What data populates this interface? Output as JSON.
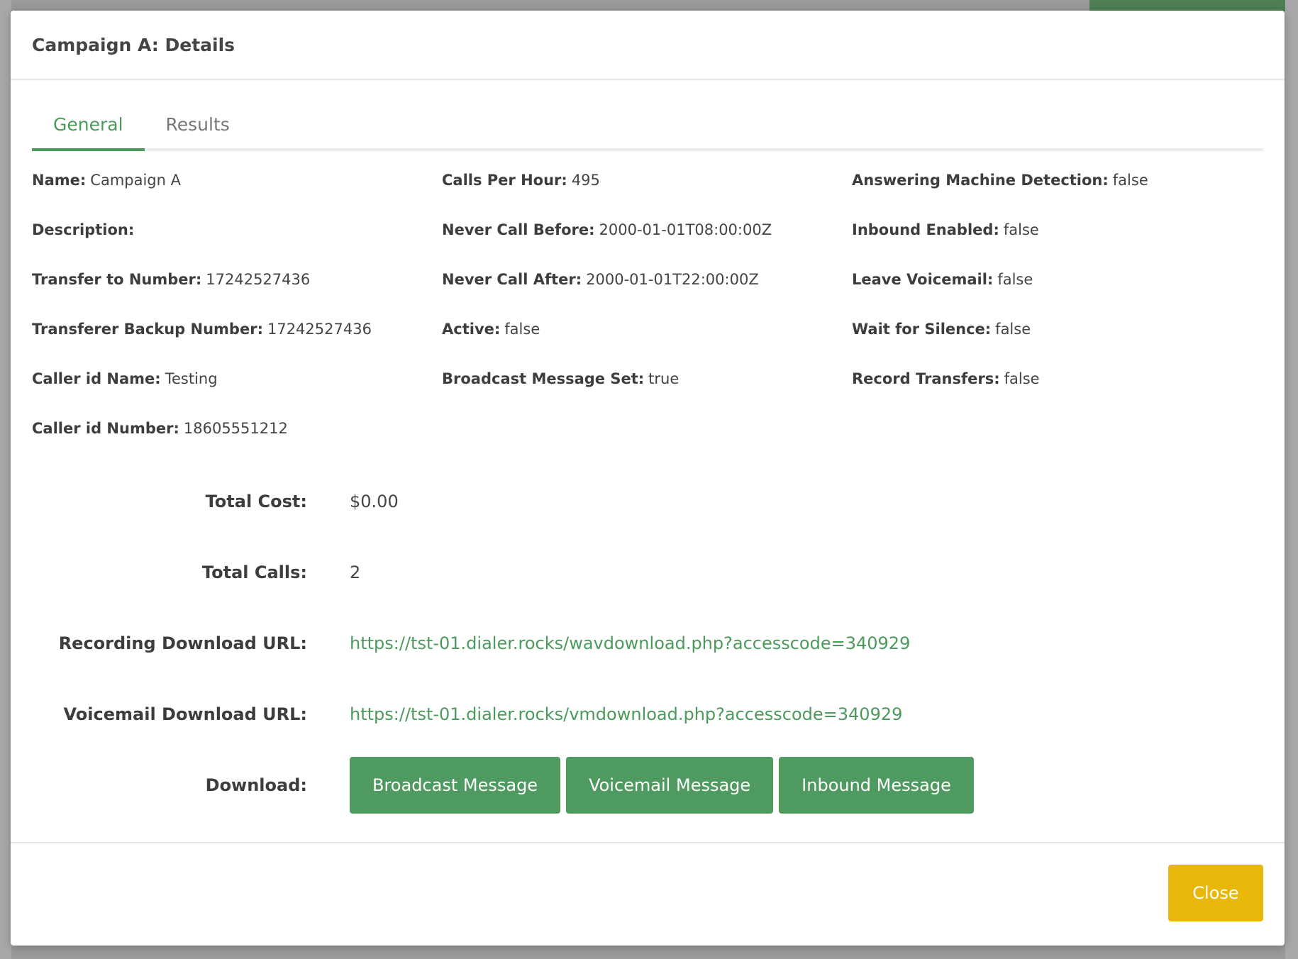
{
  "modal": {
    "title": "Campaign A: Details"
  },
  "tabs": [
    {
      "label": "General",
      "active": true
    },
    {
      "label": "Results",
      "active": false
    }
  ],
  "details": {
    "col1": [
      {
        "label": "Name:",
        "value": "Campaign A"
      },
      {
        "label": "Description:",
        "value": ""
      },
      {
        "label": "Transfer to Number:",
        "value": "17242527436"
      },
      {
        "label": "Transferer Backup Number:",
        "value": "17242527436"
      },
      {
        "label": "Caller id Name:",
        "value": "Testing"
      },
      {
        "label": "Caller id Number:",
        "value": "18605551212"
      }
    ],
    "col2": [
      {
        "label": "Calls Per Hour:",
        "value": "495"
      },
      {
        "label": "Never Call Before:",
        "value": "2000-01-01T08:00:00Z"
      },
      {
        "label": "Never Call After:",
        "value": "2000-01-01T22:00:00Z"
      },
      {
        "label": "Active:",
        "value": "false"
      },
      {
        "label": "Broadcast Message Set:",
        "value": "true"
      }
    ],
    "col3": [
      {
        "label": "Answering Machine Detection:",
        "value": "false"
      },
      {
        "label": "Inbound Enabled:",
        "value": "false"
      },
      {
        "label": "Leave Voicemail:",
        "value": "false"
      },
      {
        "label": "Wait for Silence:",
        "value": "false"
      },
      {
        "label": "Record Transfers:",
        "value": "false"
      }
    ]
  },
  "summary": {
    "total_cost_label": "Total Cost:",
    "total_cost_value": "$0.00",
    "total_calls_label": "Total Calls:",
    "total_calls_value": "2",
    "recording_url_label": "Recording Download URL:",
    "recording_url_value": "https://tst-01.dialer.rocks/wavdownload.php?accesscode=340929",
    "voicemail_url_label": "Voicemail Download URL:",
    "voicemail_url_value": "https://tst-01.dialer.rocks/vmdownload.php?accesscode=340929",
    "download_label": "Download:",
    "download_buttons": [
      "Broadcast Message",
      "Voicemail Message",
      "Inbound Message"
    ]
  },
  "footer": {
    "close_label": "Close"
  },
  "colors": {
    "accent_green": "#4b9a5b",
    "button_green": "#4f9a60",
    "close_yellow": "#e8b70a"
  }
}
